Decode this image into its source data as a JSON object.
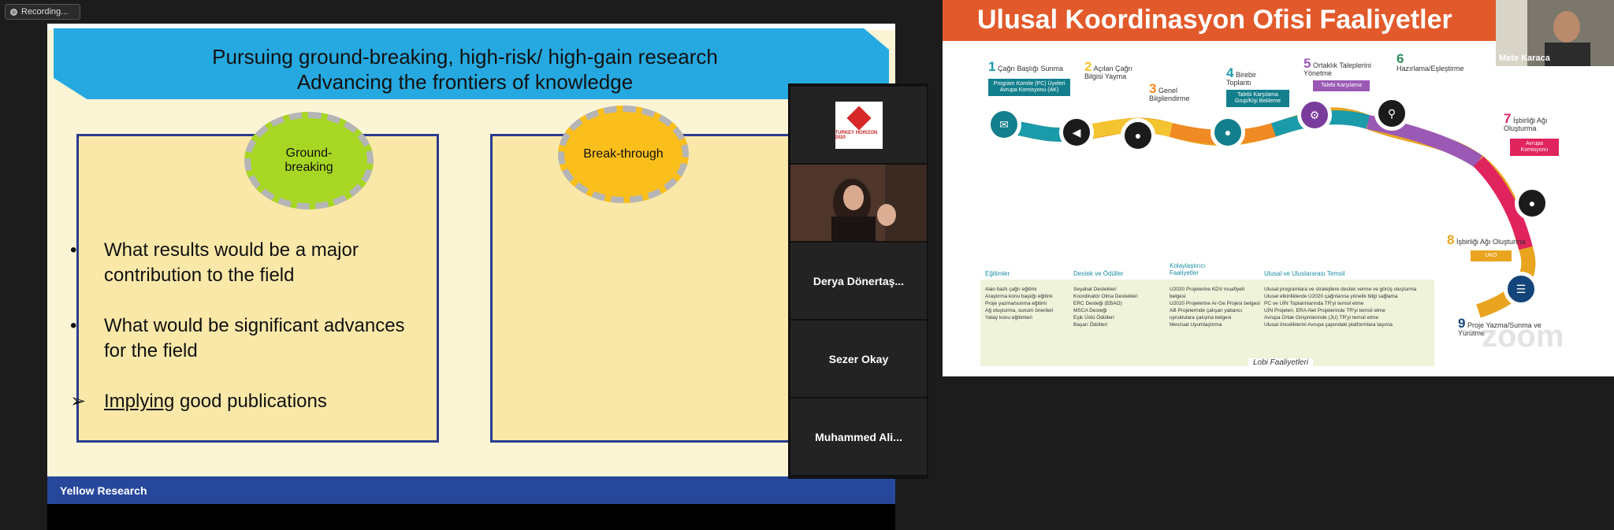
{
  "recording": {
    "label": "Recording..."
  },
  "slide": {
    "title_line1": "Pursuing ground-breaking, high-risk/ high-gain research",
    "title_line2": "Advancing the frontiers of knowledge",
    "oval_left": "Ground-breaking",
    "oval_right": "Break-through",
    "bullet1": "What results would be a major contribution to the field",
    "bullet2": "What would be significant advances for the field",
    "bullet3_underlined": "Implying",
    "bullet3_rest": " good publications",
    "footer": "Yellow Research",
    "colors": {
      "header": "#26a9e0",
      "footer": "#27479b",
      "box_border": "#2b3c8f",
      "oval_left": "#a7d722",
      "oval_right": "#fbbf1b"
    }
  },
  "participants": {
    "logo_text": "TURKEY HORIZON 2020",
    "p1": "Derya Dönertaş...",
    "p2": "Sezer Okay",
    "p3": "Muhammed Ali..."
  },
  "share": {
    "title": "Ulusal Koordinasyon Ofisi Faaliyetler",
    "self_name": "Mete Karaca",
    "steps": [
      {
        "n": "1",
        "label": "Çağrı Başlığı Sunma"
      },
      {
        "n": "2",
        "label": "Açılan Çağrı Bilgisi Yayma"
      },
      {
        "n": "3",
        "label": "Genel Bilgilendirme"
      },
      {
        "n": "4",
        "label": "Birebir Toplantı"
      },
      {
        "n": "5",
        "label": "Ortaklık Taleplerini Yönetme"
      },
      {
        "n": "6",
        "label": "Hazırlama/Eşleştirme"
      },
      {
        "n": "7",
        "label": "İşbirliği Ağı Oluşturma"
      },
      {
        "n": "8",
        "label": "İşbirliği Ağı Oluşturma"
      },
      {
        "n": "9",
        "label": "Proje Yazma/Sunma ve Yürütme"
      }
    ],
    "tags": {
      "t1": "Program Komite (PC) Üyeleri Avrupa Komisyonu (AK)",
      "t2": "Talebi Karşılama Grup/Kişi Bekleme",
      "t3": "Talebi Karşılama",
      "t4": "Avrupa Komisyonu",
      "t5": "UKO"
    },
    "lower": {
      "h1": "Eğitimler",
      "h2": "Destek ve Ödüller",
      "h3": "Kolaylaştırıcı Faaliyetler",
      "h4": "Ulusal ve Uluslararası Temsil",
      "c1": "Alan bazlı çağrı eğitimi\nAraştırma konu başlığı eğitimi\nProje yazma/sunma eğitimi\nAğ oluşturma, sunum önerileri\nYatay konu eğitimleri",
      "c2": "Seyahat Destekleri\nKoordinatör Olma Destekleri\nERC Desteği (EBAO)\nMSCA Desteği\nEşik Üstü Ödülleri\nBaşarı Ödülleri",
      "c3": "U2020 Projelerine KDV muafiyeti belgesi\nU2020 Projelerine Ar-Ge Projesi belgesi\nAB Projelerinde çalışan yabancı uyruklulara çalışma belgesi\nMevzuat Uyumlaştırma",
      "c4": "Ulusal programlara ve stratejilere destek verme ve görüş oluşturma\nUlusal etkinliklerde U2020 çağrılarına yönelik bilgi sağlama\nPC ve UİN Toplantılarında TR'yi temsil etme\nUİN Projeleri, ERA-Net Projelerinde TR'yi temsil etme\nAvrupa Ortak Girişimlerinde (JU) TR'yi temsil etme\nUlusal önceliklerini Avrupa çapındaki platformlara taşıma",
      "lobby": "Lobi Faaliyetleri"
    },
    "watermark": "zoom"
  }
}
